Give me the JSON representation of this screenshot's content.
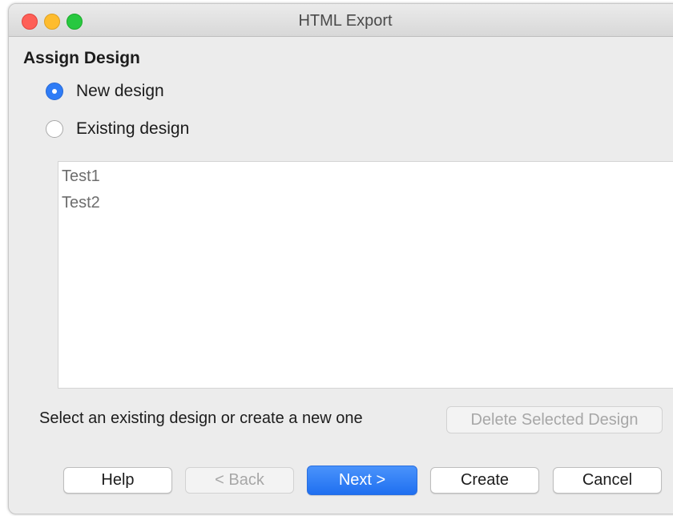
{
  "window": {
    "title": "HTML Export"
  },
  "section": {
    "title": "Assign Design"
  },
  "radios": {
    "new_design": {
      "label": "New design",
      "checked": true
    },
    "existing_design": {
      "label": "Existing design",
      "checked": false
    }
  },
  "design_list": {
    "items": [
      "Test1",
      "Test2"
    ]
  },
  "hint": "Select an existing design or create a new one",
  "buttons": {
    "delete_selected": "Delete Selected Design",
    "help": "Help",
    "back": "< Back",
    "next": "Next >",
    "create": "Create",
    "cancel": "Cancel"
  },
  "colors": {
    "accent": "#2f7cf6",
    "close": "#fe5f57",
    "minimize": "#febc2e",
    "maximize": "#28c840"
  }
}
